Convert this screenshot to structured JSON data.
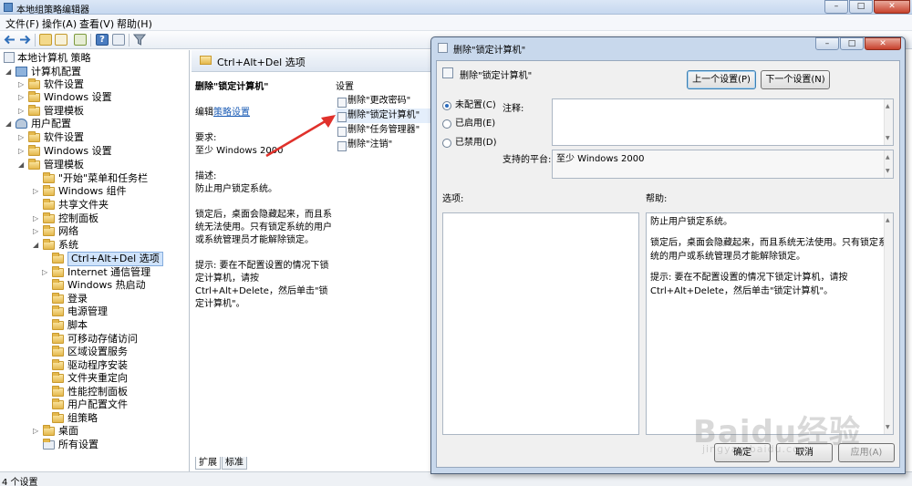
{
  "window": {
    "title": "本地组策略编辑器",
    "buttons": {
      "min": "–",
      "max": "□",
      "close": "✕"
    }
  },
  "menu": [
    "文件(F)",
    "操作(A)",
    "查看(V)",
    "帮助(H)"
  ],
  "tree": {
    "root": "本地计算机 策略",
    "computer_config": "计算机配置",
    "cc_software": "软件设置",
    "cc_windows": "Windows 设置",
    "cc_admin": "管理模板",
    "user_config": "用户配置",
    "uc_software": "软件设置",
    "uc_windows": "Windows 设置",
    "uc_admin": "管理模板",
    "start_menu": "\"开始\"菜单和任务栏",
    "win_components": "Windows 组件",
    "shared_folders": "共享文件夹",
    "control_panel": "控制面板",
    "network": "网络",
    "system": "系统",
    "ctrl_alt_del": "Ctrl+Alt+Del 选项",
    "internet_comm": "Internet 通信管理",
    "win_hotstart": "Windows 热启动",
    "logon": "登录",
    "power": "电源管理",
    "scripts": "脚本",
    "removable": "可移动存储访问",
    "locale": "区域设置服务",
    "driver": "驱动程序安装",
    "folder_redirect": "文件夹重定向",
    "perf_cp": "性能控制面板",
    "user_profiles": "用户配置文件",
    "group_policy": "组策略",
    "desktop": "桌面",
    "all_settings": "所有设置"
  },
  "middle": {
    "header": "Ctrl+Alt+Del 选项",
    "setting_title": "删除\"锁定计算机\"",
    "edit_prefix": "编辑",
    "edit_link": "策略设置",
    "req_label": "要求:",
    "req_value": "至少 Windows 2000",
    "desc_label": "描述:",
    "desc_value": "防止用户锁定系统。",
    "desc_detail": "锁定后，桌面会隐藏起来，而且系统无法使用。只有锁定系统的用户或系统管理员才能解除锁定。",
    "tip": "提示: 要在不配置设置的情况下锁定计算机，请按 Ctrl+Alt+Delete，然后单击\"锁定计算机\"。",
    "list_header": "设置",
    "list_items": [
      "删除\"更改密码\"",
      "删除\"锁定计算机\"",
      "删除\"任务管理器\"",
      "删除\"注销\""
    ],
    "tabs": [
      "扩展",
      "标准"
    ]
  },
  "status": "4 个设置",
  "dialog": {
    "title": "删除\"锁定计算机\"",
    "header": "删除\"锁定计算机\"",
    "prev_button": "上一个设置(P)",
    "next_button": "下一个设置(N)",
    "radio_not_configured": "未配置(C)",
    "radio_enabled": "已启用(E)",
    "radio_disabled": "已禁用(D)",
    "comment_label": "注释:",
    "supported_label": "支持的平台:",
    "supported_value": "至少 Windows 2000",
    "options_label": "选项:",
    "help_label": "帮助:",
    "help_p1": "防止用户锁定系统。",
    "help_p2": "锁定后，桌面会隐藏起来，而且系统无法使用。只有锁定系统的用户或系统管理员才能解除锁定。",
    "help_p3": "提示: 要在不配置设置的情况下锁定计算机，请按 Ctrl+Alt+Delete，然后单击\"锁定计算机\"。",
    "ok": "确定",
    "cancel": "取消",
    "apply": "应用(A)"
  },
  "watermark": {
    "logo": "Baidu经验",
    "url": "jingyan.baidu.com"
  },
  "colors": {
    "accent": "#1a5bb5",
    "arrow": "#e0312b"
  }
}
